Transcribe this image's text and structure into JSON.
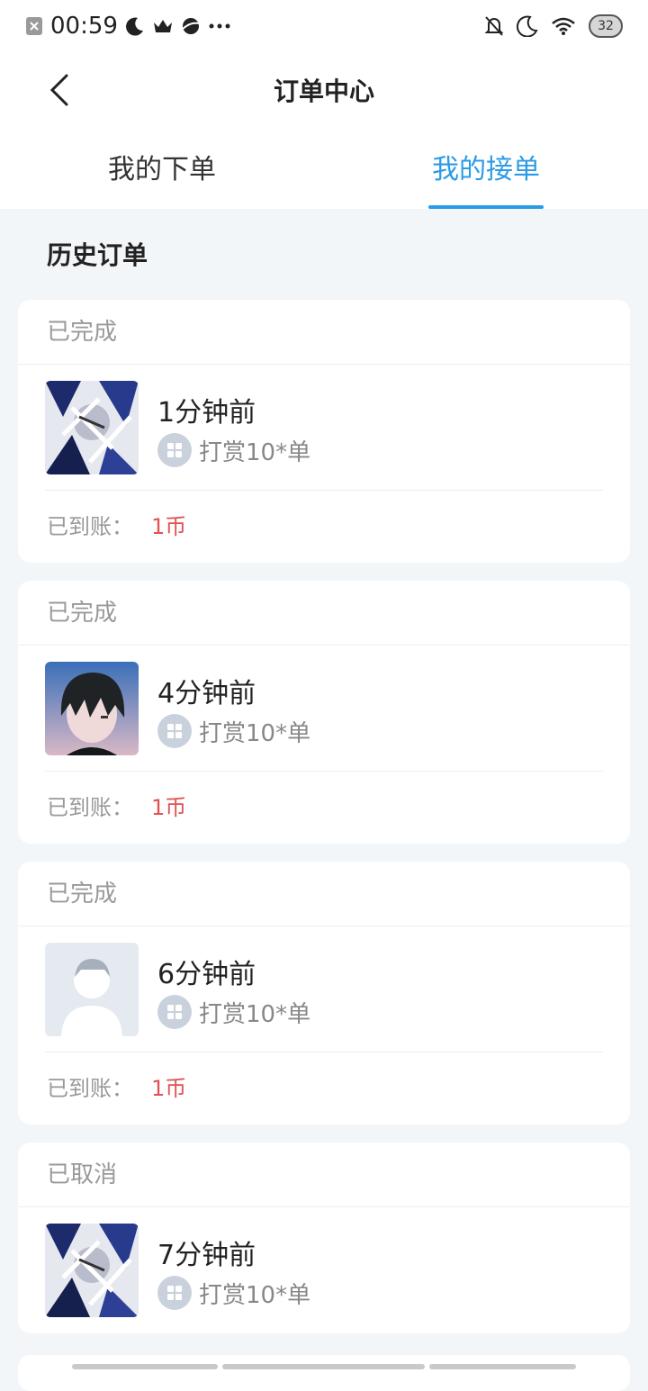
{
  "status_bar": {
    "time": "00:59",
    "battery": "32",
    "icons_left": [
      "close-box-icon",
      "moon-icon",
      "crown-icon",
      "planet-icon",
      "more-dots-icon"
    ],
    "icons_right": [
      "bell-off-icon",
      "moon-icon",
      "wifi-icon",
      "battery-icon"
    ]
  },
  "nav": {
    "title": "订单中心"
  },
  "tabs": [
    {
      "label": "我的下单",
      "active": false
    },
    {
      "label": "我的接单",
      "active": true
    }
  ],
  "section_title": "历史订单",
  "orders": [
    {
      "status": "已完成",
      "time": "1分钟前",
      "desc": "打赏10*单",
      "footer_label": "已到账：",
      "amount": "1币",
      "avatar": "anime-art"
    },
    {
      "status": "已完成",
      "time": "4分钟前",
      "desc": "打赏10*单",
      "footer_label": "已到账：",
      "amount": "1币",
      "avatar": "anime-boy"
    },
    {
      "status": "已完成",
      "time": "6分钟前",
      "desc": "打赏10*单",
      "footer_label": "已到账：",
      "amount": "1币",
      "avatar": "default-avatar"
    },
    {
      "status": "已取消",
      "time": "7分钟前",
      "desc": "打赏10*单",
      "avatar": "anime-art"
    }
  ],
  "colors": {
    "accent": "#2b9be6",
    "amount": "#e05252",
    "background": "#f3f6f9"
  }
}
